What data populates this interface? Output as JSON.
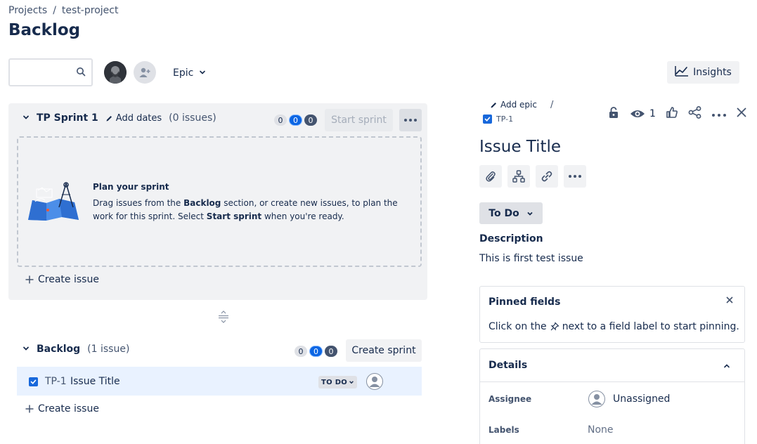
{
  "breadcrumb": {
    "root": "Projects",
    "separator": "/",
    "project": "test-project"
  },
  "page_title": "Backlog",
  "toolbar": {
    "search_placeholder": "",
    "search_value": "",
    "epic_label": "Epic",
    "insights_label": "Insights"
  },
  "sprint": {
    "name": "TP Sprint 1",
    "add_dates_label": "Add dates",
    "issue_count": "(0 issues)",
    "badges": [
      "0",
      "0",
      "0"
    ],
    "start_label": "Start sprint",
    "empty_title": "Plan your sprint",
    "empty_text_1": "Drag issues from the ",
    "empty_bold_1": "Backlog",
    "empty_text_2": " section, or create new issues, to plan the work for this sprint. Select ",
    "empty_bold_2": "Start sprint",
    "empty_text_3": " when you're ready.",
    "create_issue_label": "Create issue"
  },
  "backlog": {
    "name": "Backlog",
    "issue_count": "(1 issue)",
    "badges": [
      "0",
      "0",
      "0"
    ],
    "create_sprint_label": "Create sprint",
    "issues": [
      {
        "key": "TP-1",
        "title": "Issue Title",
        "status": "TO DO"
      }
    ],
    "create_issue_label": "Create issue"
  },
  "issue_panel": {
    "add_epic_label": "Add epic",
    "separator": "/",
    "key": "TP-1",
    "watchers": "1",
    "title": "Issue Title",
    "status_button": "To Do",
    "description_label": "Description",
    "description_text": "This is first test issue",
    "pinned_title": "Pinned fields",
    "pinned_text_before": "Click on the",
    "pinned_text_after": "next to a field label to start pinning.",
    "details_title": "Details",
    "assignee_label": "Assignee",
    "assignee_value": "Unassigned",
    "labels_label": "Labels",
    "labels_value": "None"
  },
  "colors": {
    "accent": "#0c66e4",
    "row_highlight": "#e9f2ff",
    "panel_bg": "#f1f2f4"
  }
}
